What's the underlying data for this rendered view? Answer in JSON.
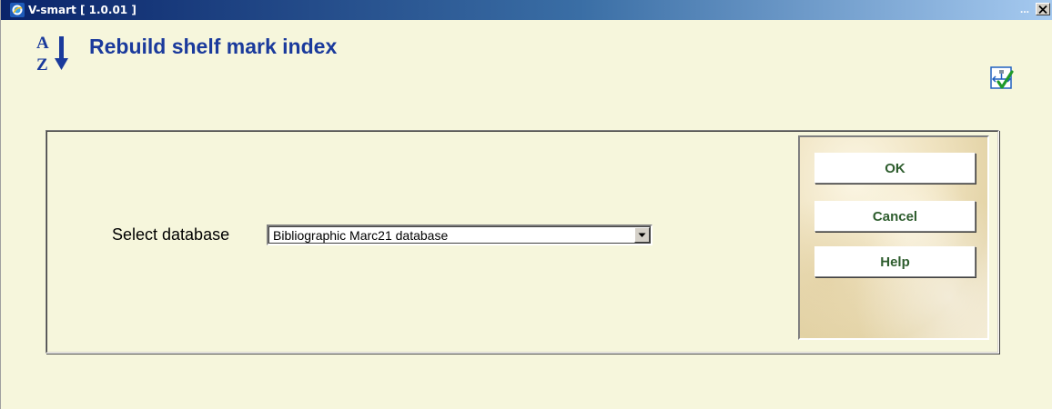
{
  "window": {
    "title": "V-smart [ 1.0.01 ]",
    "title_ellipsis": "...",
    "close_label": "x"
  },
  "header": {
    "title": "Rebuild shelf mark index",
    "sort_icon": "sort-az-icon",
    "confirm_icon": "confirm-checkmark-icon"
  },
  "form": {
    "select_label": "Select database",
    "database_value": "Bibliographic Marc21 database"
  },
  "actions": {
    "ok_label": "OK",
    "cancel_label": "Cancel",
    "help_label": "Help"
  },
  "colors": {
    "title_color": "#1a3a9c",
    "background": "#f6f6dc",
    "button_text": "#2e5d2e"
  }
}
